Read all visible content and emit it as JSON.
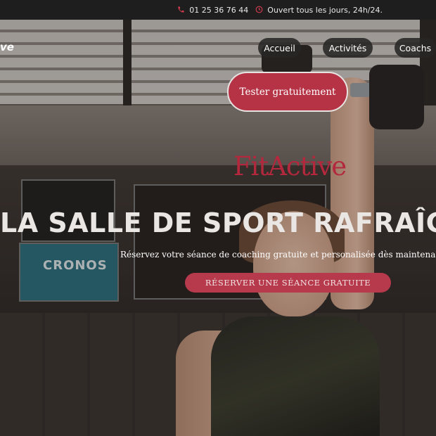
{
  "topbar": {
    "phone_icon": "phone-icon",
    "phone": "01 25 36 76 44",
    "clock_icon": "clock-icon",
    "hours": "Ouvert tous les jours, 24h/24."
  },
  "header": {
    "brand_partial": "ve",
    "nav": [
      {
        "label": "Accueil"
      },
      {
        "label": "Activités"
      },
      {
        "label": "Coachs"
      }
    ],
    "cta_label": "Tester gratuitement"
  },
  "hero": {
    "logo": "FitActive",
    "title": "LA SALLE DE SPORT RAFRAÎCH",
    "subtitle": "Réservez votre séance de coaching gratuite et personalisée dès maintena",
    "cta_label": "RÉSERVER UNE SÉANCE GRATUITE",
    "background_banner_text": "CRONOS"
  },
  "colors": {
    "accent": "#b63346",
    "topbar_bg": "#1e1e1e",
    "icon_accent": "#d13b4f",
    "logo_color": "#b3283d"
  }
}
